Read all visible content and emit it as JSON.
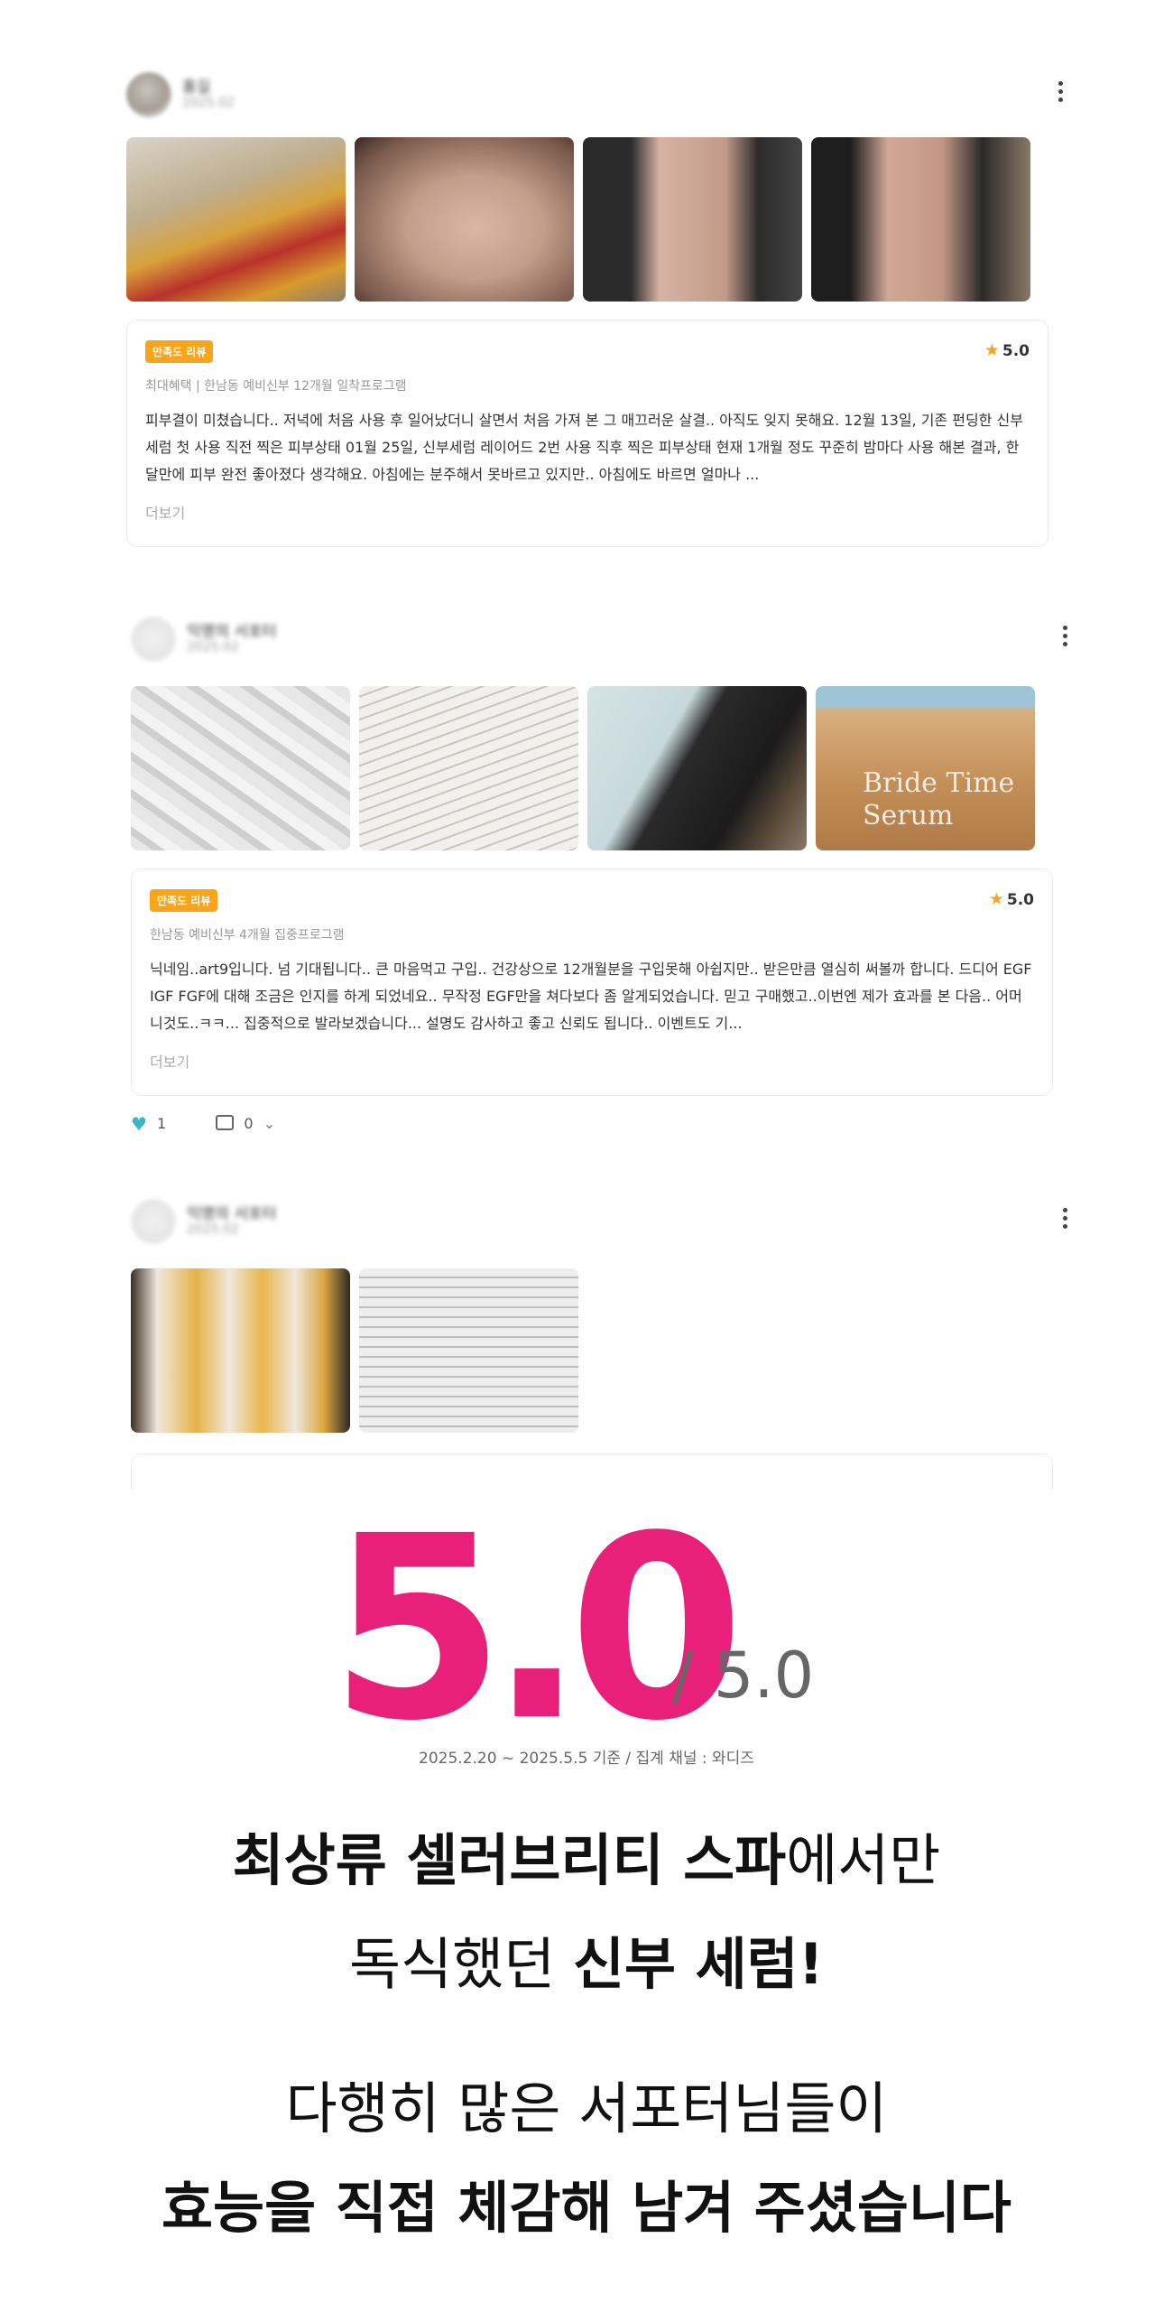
{
  "reviews": [
    {
      "badge": "만족도 리뷰",
      "rating": "5.0",
      "meta": "최대혜택 | 한남동 예비신부 12개월 일착프로그램",
      "text": "피부결이 미쳤습니다.. 저녁에 처음 사용 후 일어났더니 살면서 처음 가져 본 그 매끄러운 살결.. 아직도 잊지 못해요. 12월 13일, 기존 펀딩한 신부세럼 첫 사용 직전 찍은 피부상태 01월 25일, 신부세럼 레이어드 2번 사용 직후 찍은 피부상태 현재 1개월 정도 꾸준히 밤마다 사용 해본 결과, 한달만에 피부 완전 좋아졌다 생각해요. 아침에는 분주해서 못바르고 있지만.. 아침에도 바르면 얼마나 ...",
      "more": "더보기"
    },
    {
      "badge": "만족도 리뷰",
      "rating": "5.0",
      "meta": "한남동 예비신부 4개월 집중프로그램",
      "text": "닉네임..art9입니다. 넘 기대됩니다.. 큰 마음먹고 구입.. 건강상으로 12개월분을 구입못해 아쉽지만.. 받은만큼 열심히 써볼까 합니다. 드디어 EGF IGF FGF에 대해 조금은 인지를 하게 되었네요.. 무작정 EGF만을 쳐다보다 좀 알게되었습니다. 믿고 구매했고..이번엔 제가 효과를 본 다음.. 어머니것도..ㅋㅋ... 집중적으로 발라보겠습니다... 설명도 감사하고 좋고 신뢰도 됩니다.. 이벤트도 기...",
      "more": "더보기",
      "likes": "1",
      "comments": "0"
    }
  ],
  "photo_text": {
    "serum_label": "Bride Time Serum"
  },
  "summary": {
    "score": "5.0",
    "out_of": "/ 5.0",
    "basis": "2025.2.20 ~ 2025.5.5 기준 / 집계 채널 : 와디즈"
  },
  "copy": {
    "line1_bold": "최상류 셀러브리티 스파",
    "line1_rest": "에서만",
    "line2_pre": "독식했던 ",
    "line2_bold": "신부 세럼!",
    "line3": "다행히 많은 서포터님들이",
    "line4": "효능을 직접 체감해 남겨 주셨습니다"
  },
  "colors": {
    "accent": "#e8207a",
    "badge": "#f8a51c",
    "star": "#f5a623",
    "like": "#3bb6c2"
  }
}
